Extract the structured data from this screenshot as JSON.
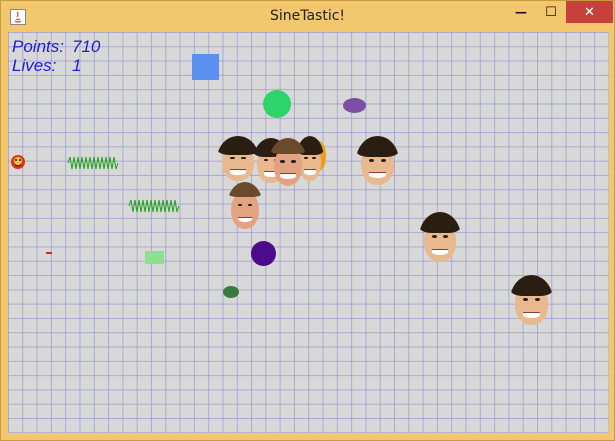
{
  "window": {
    "title": "SineTastic!"
  },
  "controls": {
    "minimize": "—",
    "maximize": "☐",
    "close": "✕"
  },
  "hud": {
    "points_label": "Points:",
    "points_value": "710",
    "lives_label": "Lives:",
    "lives_value": "1"
  },
  "colors": {
    "hud_text": "#1c1cd6",
    "blue_square": "#5b8ff0",
    "green_circle": "#2dd46a",
    "purple_ellipse": "#7b4fa3",
    "orange_ellipse": "#e8a01c",
    "dark_purple_circle": "#4b0b8a",
    "dark_green_ellipse": "#3a7a3a",
    "light_green_rect": "#8be08b",
    "red_dash": "#e02020",
    "sine_wave": "#1fa01f"
  }
}
